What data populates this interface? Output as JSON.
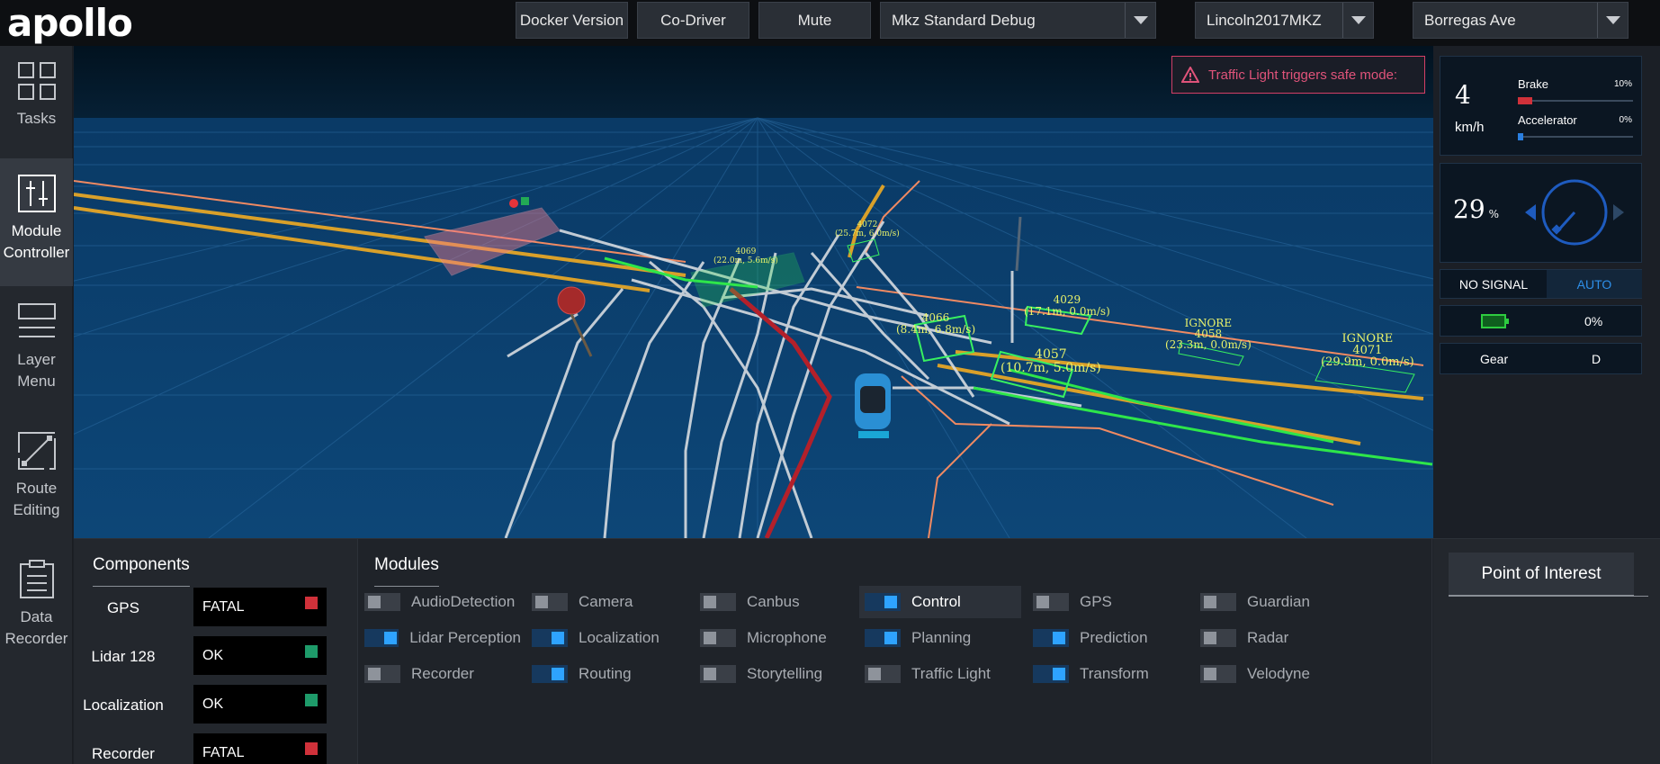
{
  "header": {
    "logo": "apollo",
    "docker_btn": "Docker Version",
    "codriver_btn": "Co-Driver",
    "mute_btn": "Mute",
    "mode_select": "Mkz Standard Debug",
    "vehicle_select": "Lincoln2017MKZ",
    "map_select": "Borregas Ave"
  },
  "nav": {
    "tasks": "Tasks",
    "module_controller_1": "Module",
    "module_controller_2": "Controller",
    "layer_menu_1": "Layer",
    "layer_menu_2": "Menu",
    "route_editing_1": "Route",
    "route_editing_2": "Editing",
    "data_recorder_1": "Data",
    "data_recorder_2": "Recorder"
  },
  "alert": {
    "text": "Traffic Light triggers safe mode:"
  },
  "dashboard": {
    "speed": "4",
    "speed_unit": "km/h",
    "brake_label": "Brake",
    "brake_pct": "10%",
    "brake_value": 0.1,
    "accel_label": "Accelerator",
    "accel_pct": "0%",
    "accel_value": 0.0,
    "steering_pct": "29",
    "steering_unit": "%",
    "signal": "NO SIGNAL",
    "drive_mode": "AUTO",
    "battery_pct": "0%",
    "gear_label": "Gear",
    "gear_value": "D"
  },
  "scene_labels": {
    "obs4069_id": "4069",
    "obs4069_info": "(22.0m, 5.6m/s)",
    "obs4072_id": "4072",
    "obs4072_info": "(25.7m, 6.0m/s)",
    "obs4066_id": "4066",
    "obs4066_info": "(8.4m, 6.8m/s)",
    "obs4029_id": "4029",
    "obs4029_info": "(17.1m, 0.0m/s)",
    "obs4057_id": "4057",
    "obs4057_info": "(10.7m, 5.0m/s)",
    "obs4058_tag": "IGNORE",
    "obs4058_id": "4058",
    "obs4058_info": "(23.3m, 0.0m/s)",
    "obs4071_tag": "IGNORE",
    "obs4071_id": "4071",
    "obs4071_info": "(29.9m, 0.0m/s)"
  },
  "components": {
    "title": "Components",
    "items": [
      {
        "name": "GPS",
        "status": "FATAL",
        "color": "#d0313a"
      },
      {
        "name": "Lidar 128",
        "status": "OK",
        "color": "#1e9b6a"
      },
      {
        "name": "Localization",
        "status": "OK",
        "color": "#1e9b6a"
      },
      {
        "name": "Recorder",
        "status": "FATAL",
        "color": "#d0313a"
      }
    ]
  },
  "modules": {
    "title": "Modules",
    "items": [
      {
        "name": "AudioDetection",
        "on": false
      },
      {
        "name": "Camera",
        "on": false
      },
      {
        "name": "Canbus",
        "on": false
      },
      {
        "name": "Control",
        "on": true
      },
      {
        "name": "GPS",
        "on": false
      },
      {
        "name": "Guardian",
        "on": false
      },
      {
        "name": "Lidar Perception",
        "on": true
      },
      {
        "name": "Localization",
        "on": true
      },
      {
        "name": "Microphone",
        "on": false
      },
      {
        "name": "Planning",
        "on": true
      },
      {
        "name": "Prediction",
        "on": true
      },
      {
        "name": "Radar",
        "on": false
      },
      {
        "name": "Recorder",
        "on": false
      },
      {
        "name": "Routing",
        "on": true
      },
      {
        "name": "Storytelling",
        "on": false
      },
      {
        "name": "Traffic Light",
        "on": false
      },
      {
        "name": "Transform",
        "on": true
      },
      {
        "name": "Velodyne",
        "on": false
      }
    ]
  },
  "poi": {
    "button": "Point of Interest"
  }
}
